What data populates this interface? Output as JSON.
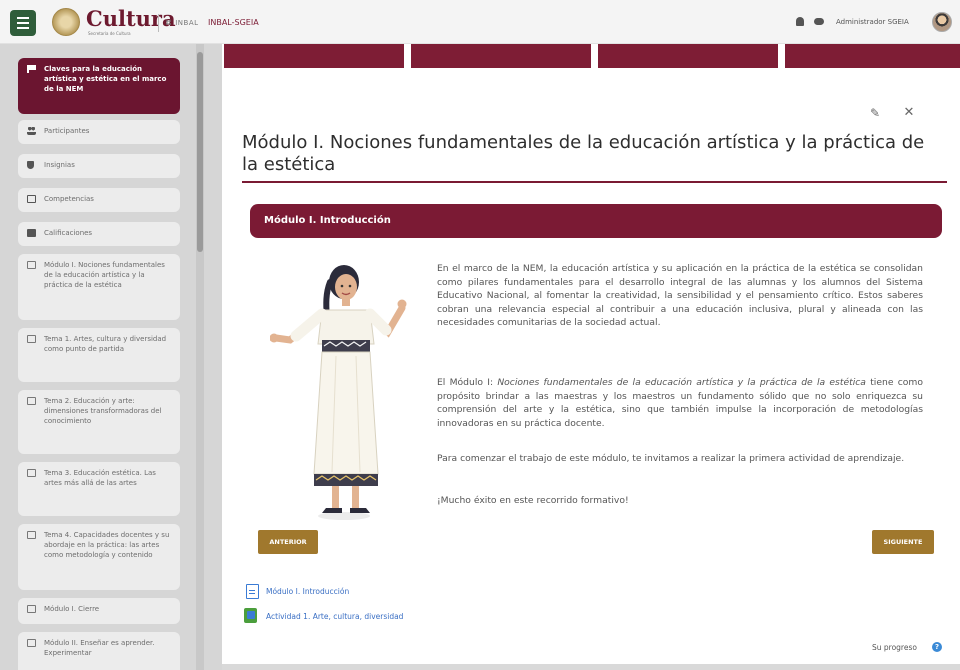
{
  "header": {
    "brand": "Cultura",
    "brand_sub": "Secretaría de Cultura",
    "inbal_logo": "⌘ INBAL",
    "site_name": "INBAL-SGEIA",
    "user_name": "Administrador SGEIA"
  },
  "sidebar": {
    "items": [
      {
        "label": "Claves para la educación artística y estética en el marco de la NEM",
        "icon": "flag-icon"
      },
      {
        "label": "Participantes",
        "icon": "users-icon"
      },
      {
        "label": "Insignias",
        "icon": "shield-icon"
      },
      {
        "label": "Competencias",
        "icon": "checkbox-icon"
      },
      {
        "label": "Calificaciones",
        "icon": "table-icon"
      },
      {
        "label": "Módulo I. Nociones fundamentales de la educación artística y la práctica de la estética",
        "icon": "folder-icon"
      },
      {
        "label": "Tema 1. Artes, cultura y diversidad como punto de partida",
        "icon": "folder-icon"
      },
      {
        "label": "Tema 2. Educación y arte: dimensiones transformadoras del conocimiento",
        "icon": "folder-icon"
      },
      {
        "label": "Tema 3. Educación estética. Las artes más allá de las artes",
        "icon": "folder-icon"
      },
      {
        "label": "Tema 4. Capacidades docentes y su abordaje en la práctica: las artes como metodología y contenido",
        "icon": "folder-icon"
      },
      {
        "label": "Módulo I. Cierre",
        "icon": "folder-icon"
      },
      {
        "label": "Módulo II. Enseñar es aprender. Experimentar",
        "icon": "folder-icon"
      }
    ]
  },
  "main": {
    "edit_glyph": "✎",
    "close_glyph": "✕",
    "page_title": "Módulo I. Nociones fundamentales de la educación artística y la práctica de la estética",
    "section_title": "Módulo I. Introducción",
    "paragraphs": {
      "p1": "En el marco de la NEM, la educación artística y su aplicación en la práctica de la estética se consolidan como pilares fundamentales para el desarrollo integral de las alumnas y los alumnos del Sistema Educativo Nacional, al fomentar la creatividad, la sensibilidad y el pensamiento crítico. Estos saberes cobran una relevancia especial al contribuir a una educación inclusiva, plural y alineada con las necesidades comunitarias de la sociedad actual.",
      "p2_pre": "El Módulo I: ",
      "p2_em": "Nociones fundamentales de la educación artística y la práctica de la estética",
      "p2_post": " tiene como propósito brindar a las maestras y los maestros un fundamento sólido que no solo enriquezca su comprensión del arte y la estética, sino que también impulse la incorporación de metodologías innovadoras en su práctica docente.",
      "p3": "Para comenzar el trabajo de este módulo, te invitamos a realizar la primera actividad de aprendizaje.",
      "p4": "¡Mucho éxito en este recorrido formativo!"
    },
    "btn_prev": "ANTERIOR",
    "btn_next": "SIGUIENTE",
    "resources": [
      {
        "label": "Módulo I. Introducción",
        "icon": "document-icon"
      },
      {
        "label": "Actividad 1. Arte, cultura, diversidad",
        "icon": "activity-icon"
      }
    ],
    "progress_label": "Su progreso",
    "help_glyph": "?"
  },
  "colors": {
    "brand_wine": "#7b1a34",
    "gold_button": "#a0782d",
    "menu_green": "#2f5d3a",
    "link_blue": "#3a6fc4"
  }
}
